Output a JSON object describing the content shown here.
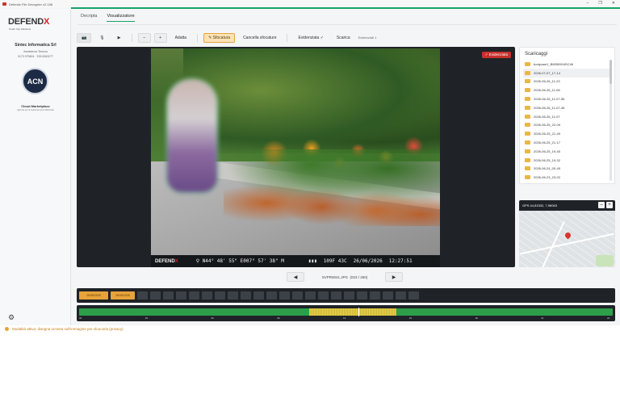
{
  "window": {
    "title": "Defendx File Decrypter v2.158",
    "controls": [
      "–",
      "❐",
      "✕"
    ]
  },
  "sidebar": {
    "logo_main": "DEFEND",
    "logo_x": "X",
    "logo_sub": "Smart City Solutions",
    "company_name": "Sintec Informatica Srl",
    "company_line2": "Assistenza Tecnica",
    "company_line3": "0173 975604 · 335 6363277",
    "badge_text": "ACN",
    "cloud_title": "Cloud Marketplace",
    "cloud_sub": "Agenzia per la Cybersicurezza Nazionale"
  },
  "tabs": [
    {
      "label": "Decripta",
      "active": false
    },
    {
      "label": "Visualizzatore",
      "active": true
    }
  ],
  "toolbar": {
    "zoom_out": "–",
    "zoom_in": "+",
    "fit": "Adatta",
    "blur": "Sfocatura",
    "clear_blur": "Cancella sfocature",
    "evidence": "Evidenziata ✓",
    "download": "Scarica",
    "evidence_count": "Evidenziati 1"
  },
  "viewer": {
    "evidence_badge": "✓ Evidenziata",
    "osd_brand": "DEFEND",
    "osd_brand_x": "X",
    "osd_coords": "⚲ N44° 48' 55\" E007° 57' 38\" M",
    "osd_temp": "109F 43C",
    "osd_date": "26/06/2026",
    "osd_time": "12:27:51",
    "filename": "SVPR0041.JPG",
    "counter": "(023 / 250)"
  },
  "downloads": {
    "title": "Scaricaggi",
    "items": [
      "bodycam1_B8050904SC46",
      "2026-07-07_17-14",
      "2026-06-26_11-23",
      "2026-06-26_11-08",
      "2026-06-26_11-07-56",
      "2026-06-26_11-07-45",
      "2026-06-26_11-07",
      "2026-06-25_22-09",
      "2026-06-25_21-49",
      "2026-06-25_21-17",
      "2026-06-25_19-40",
      "2026-06-25_19-32",
      "2026-06-24_00-49",
      "2026-06-23_23-02"
    ],
    "selected_index": 1
  },
  "gps": {
    "label": "GPS 44,81532, 7,96063"
  },
  "timeline": {
    "active_day_1": "26/06/2026",
    "active_day_2": "25/06/2026",
    "inactive_day_count": 22,
    "hour_labels": [
      "00",
      "03",
      "06",
      "09",
      "12",
      "15",
      "18",
      "21",
      "24"
    ]
  },
  "status": {
    "message": "Modalità attiva: disegna un'area sull'immagine per sfuocarla (privacy)."
  },
  "colors": {
    "accent": "#1aa36a",
    "brand_red": "#d0202a",
    "highlight": "#e8a33a",
    "dark": "#1f2327"
  }
}
